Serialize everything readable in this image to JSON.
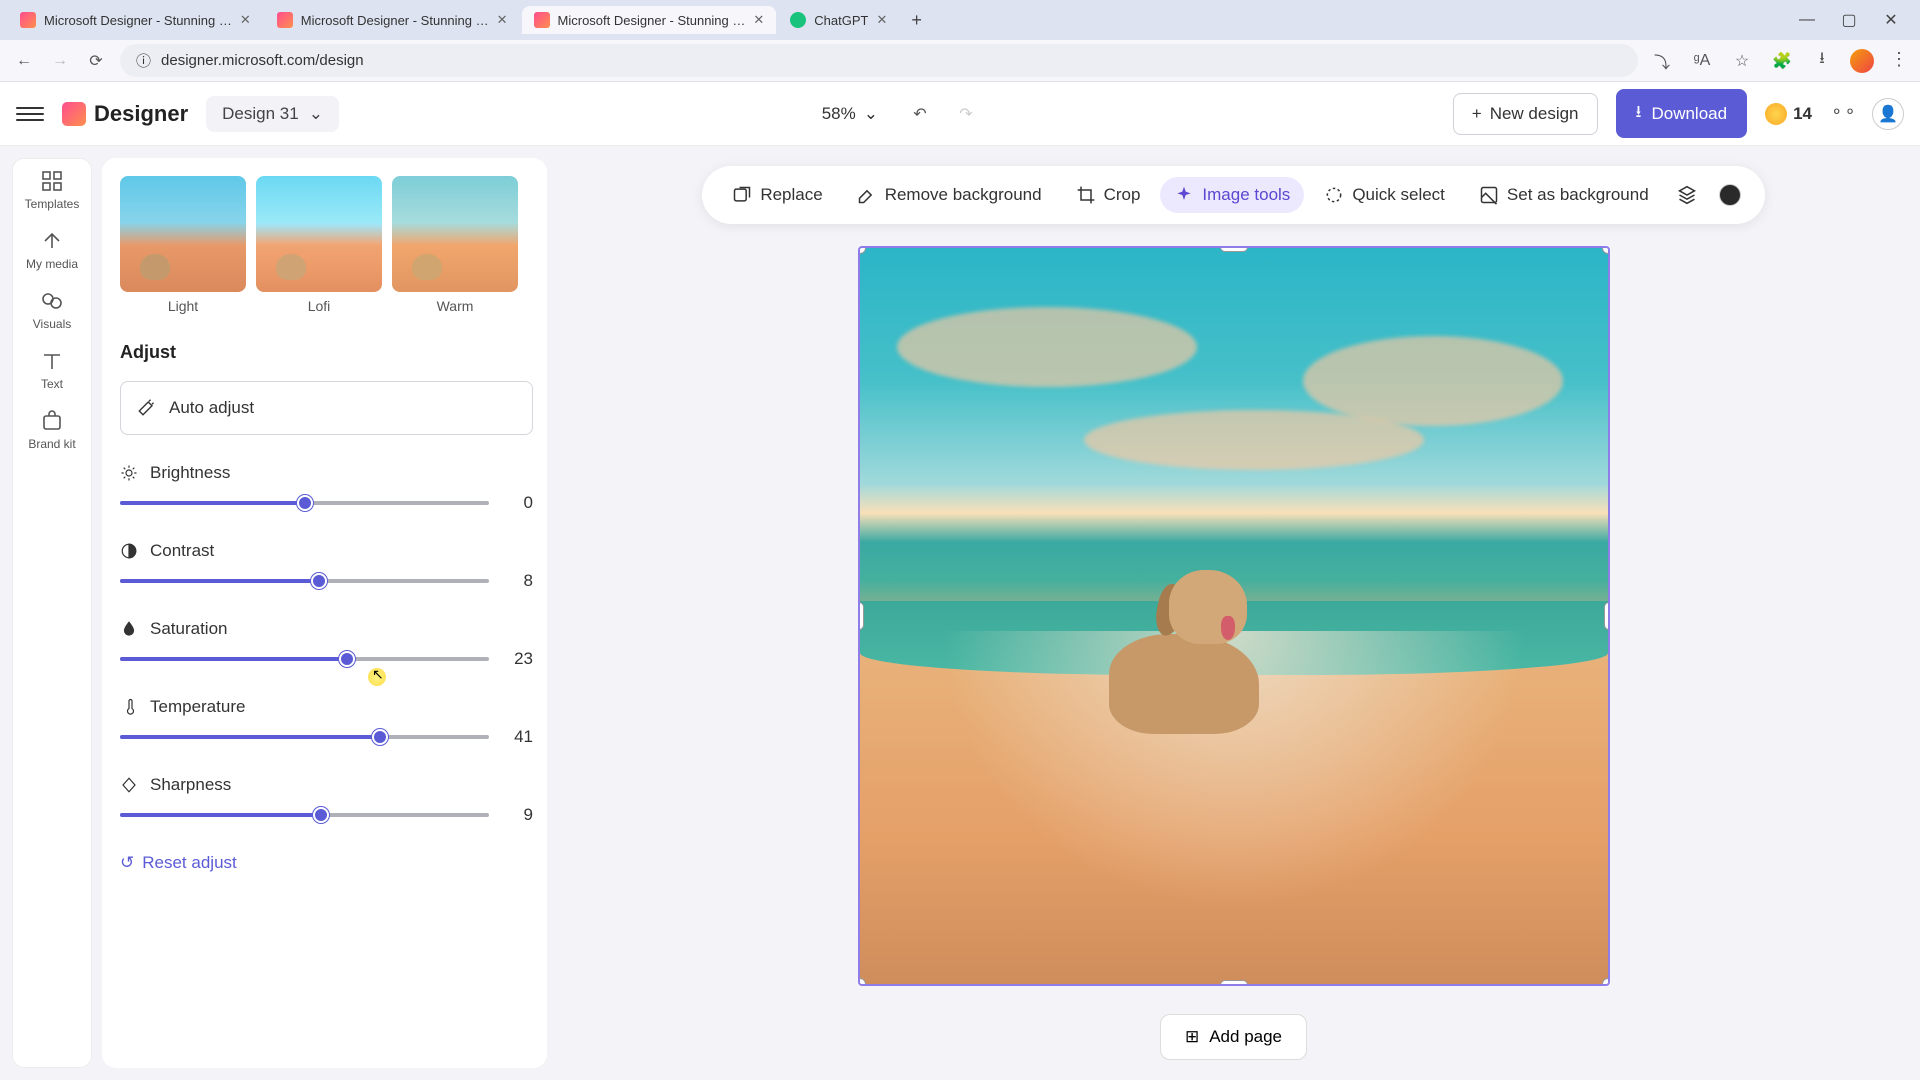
{
  "browser": {
    "tabs": [
      {
        "title": "Microsoft Designer - Stunning …",
        "favicon": "designer"
      },
      {
        "title": "Microsoft Designer - Stunning …",
        "favicon": "designer"
      },
      {
        "title": "Microsoft Designer - Stunning …",
        "favicon": "designer",
        "active": true
      },
      {
        "title": "ChatGPT",
        "favicon": "chatgpt"
      }
    ],
    "url": "designer.microsoft.com/design"
  },
  "app": {
    "logo_text": "Designer",
    "design_name": "Design 31",
    "zoom": "58%",
    "new_design": "New design",
    "download": "Download",
    "credits": "14"
  },
  "sidebar": {
    "items": [
      {
        "label": "Templates",
        "icon": "templates-icon"
      },
      {
        "label": "My media",
        "icon": "media-icon"
      },
      {
        "label": "Visuals",
        "icon": "visuals-icon"
      },
      {
        "label": "Text",
        "icon": "text-icon"
      },
      {
        "label": "Brand kit",
        "icon": "brandkit-icon"
      }
    ]
  },
  "panel": {
    "filters": [
      {
        "label": "Light"
      },
      {
        "label": "Lofi"
      },
      {
        "label": "Warm"
      }
    ],
    "section_title": "Adjust",
    "auto_adjust": "Auto adjust",
    "sliders": [
      {
        "name": "Brightness",
        "value": 0,
        "min": -100,
        "max": 100,
        "icon": "sun-icon"
      },
      {
        "name": "Contrast",
        "value": 8,
        "min": -100,
        "max": 100,
        "icon": "contrast-icon"
      },
      {
        "name": "Saturation",
        "value": 23,
        "min": -100,
        "max": 100,
        "icon": "droplet-icon"
      },
      {
        "name": "Temperature",
        "value": 41,
        "min": -100,
        "max": 100,
        "icon": "thermometer-icon"
      },
      {
        "name": "Sharpness",
        "value": 9,
        "min": -100,
        "max": 100,
        "icon": "diamond-icon"
      }
    ],
    "reset": "Reset adjust"
  },
  "toolbar": {
    "replace": "Replace",
    "remove_bg": "Remove background",
    "crop": "Crop",
    "image_tools": "Image tools",
    "quick_select": "Quick select",
    "set_bg": "Set as background"
  },
  "canvas": {
    "add_page": "Add page"
  }
}
